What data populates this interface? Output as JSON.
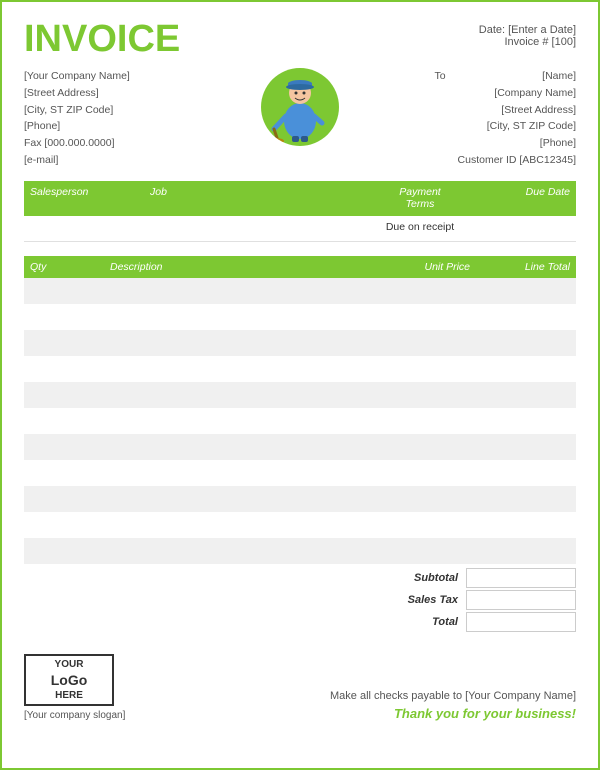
{
  "header": {
    "title": "INVOICE",
    "date_label": "Date:",
    "date_value": "[Enter a Date]",
    "invoice_label": "Invoice #",
    "invoice_number": "[100]"
  },
  "sender": {
    "company": "[Your Company Name]",
    "street": "[Street Address]",
    "city": "[City, ST  ZIP Code]",
    "phone": "[Phone]",
    "fax": "Fax [000.000.0000]",
    "email": "[e-mail]"
  },
  "to_label": "To",
  "recipient": {
    "name": "[Name]",
    "company": "[Company Name]",
    "street": "[Street Address]",
    "city": "[City, ST  ZIP Code]",
    "phone": "[Phone]",
    "customer_id": "Customer ID [ABC12345]"
  },
  "table1": {
    "headers": [
      "Salesperson",
      "Job",
      "Payment\nTerms",
      "Due Date"
    ],
    "row": {
      "salesperson": "",
      "job": "",
      "payment_terms": "Due on receipt",
      "due_date": ""
    }
  },
  "table2": {
    "headers": [
      "Qty",
      "Description",
      "Unit Price",
      "Line Total"
    ],
    "rows": [
      {
        "qty": "",
        "description": "",
        "unit_price": "",
        "line_total": ""
      },
      {
        "qty": "",
        "description": "",
        "unit_price": "",
        "line_total": ""
      },
      {
        "qty": "",
        "description": "",
        "unit_price": "",
        "line_total": ""
      },
      {
        "qty": "",
        "description": "",
        "unit_price": "",
        "line_total": ""
      },
      {
        "qty": "",
        "description": "",
        "unit_price": "",
        "line_total": ""
      },
      {
        "qty": "",
        "description": "",
        "unit_price": "",
        "line_total": ""
      },
      {
        "qty": "",
        "description": "",
        "unit_price": "",
        "line_total": ""
      },
      {
        "qty": "",
        "description": "",
        "unit_price": "",
        "line_total": ""
      },
      {
        "qty": "",
        "description": "",
        "unit_price": "",
        "line_total": ""
      },
      {
        "qty": "",
        "description": "",
        "unit_price": "",
        "line_total": ""
      },
      {
        "qty": "",
        "description": "",
        "unit_price": "",
        "line_total": ""
      }
    ]
  },
  "totals": {
    "subtotal_label": "Subtotal",
    "sales_tax_label": "Sales Tax",
    "total_label": "Total"
  },
  "footer": {
    "logo_line1": "YOUR",
    "logo_line2": "LoGo",
    "logo_line3": "HERE",
    "slogan": "[Your company slogan]",
    "checks_line": "Make all checks payable to [Your Company Name]",
    "thank_you": "Thank you for your business!"
  },
  "colors": {
    "green": "#7dc832",
    "light_gray": "#f0f0f0",
    "white": "#ffffff"
  }
}
